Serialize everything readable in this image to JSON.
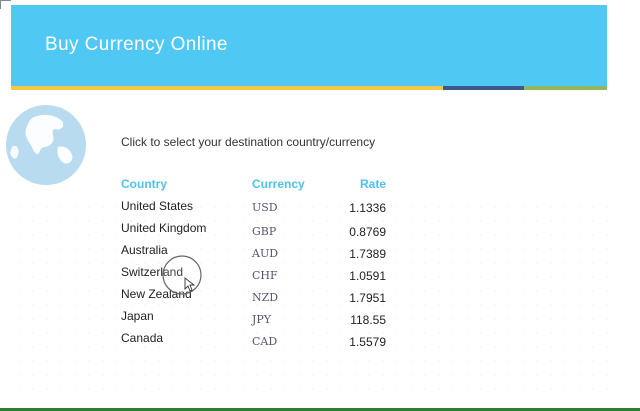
{
  "header": {
    "title": "Buy Currency Online"
  },
  "instruction": "Click to select your destination country/currency",
  "table": {
    "columns": {
      "country": "Country",
      "currency": "Currency",
      "rate": "Rate"
    },
    "rows": [
      {
        "country": "United States",
        "currency": "USD",
        "rate": "1.1336"
      },
      {
        "country": "United Kingdom",
        "currency": "GBP",
        "rate": "0.8769"
      },
      {
        "country": "Australia",
        "currency": "AUD",
        "rate": "1.7389"
      },
      {
        "country": "Switzerland",
        "currency": "CHF",
        "rate": "1.0591"
      },
      {
        "country": "New Zealand",
        "currency": "NZD",
        "rate": "1.7951"
      },
      {
        "country": "Japan",
        "currency": "JPY",
        "rate": "118.55"
      },
      {
        "country": "Canada",
        "currency": "CAD",
        "rate": "1.5579"
      }
    ]
  },
  "colors": {
    "header_bg": "#50c8f4",
    "header_text": "#ffffff",
    "column_header": "#4fc0ec",
    "stripe_yellow": "#f4c842",
    "stripe_navy": "#3a5a8c",
    "stripe_green": "#8fb85c"
  },
  "icons": {
    "globe": "globe-icon",
    "cursor": "mouse-cursor-icon"
  }
}
